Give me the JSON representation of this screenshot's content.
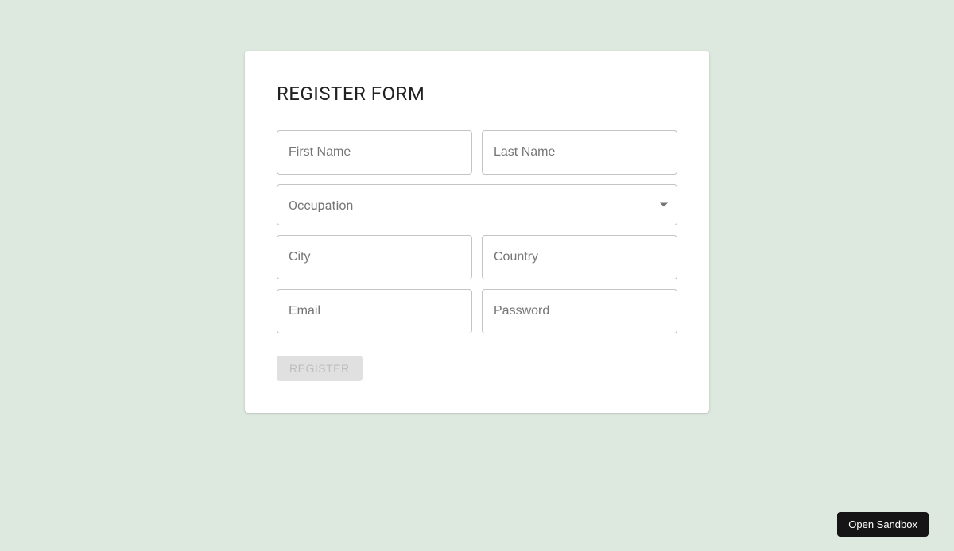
{
  "form": {
    "title": "REGISTER FORM",
    "fields": {
      "first_name": {
        "placeholder": "First Name",
        "value": ""
      },
      "last_name": {
        "placeholder": "Last Name",
        "value": ""
      },
      "occupation": {
        "label": "Occupation",
        "value": ""
      },
      "city": {
        "placeholder": "City",
        "value": ""
      },
      "country": {
        "placeholder": "Country",
        "value": ""
      },
      "email": {
        "placeholder": "Email",
        "value": ""
      },
      "password": {
        "placeholder": "Password",
        "value": ""
      }
    },
    "submit_label": "REGISTER"
  },
  "sandbox_button_label": "Open Sandbox"
}
